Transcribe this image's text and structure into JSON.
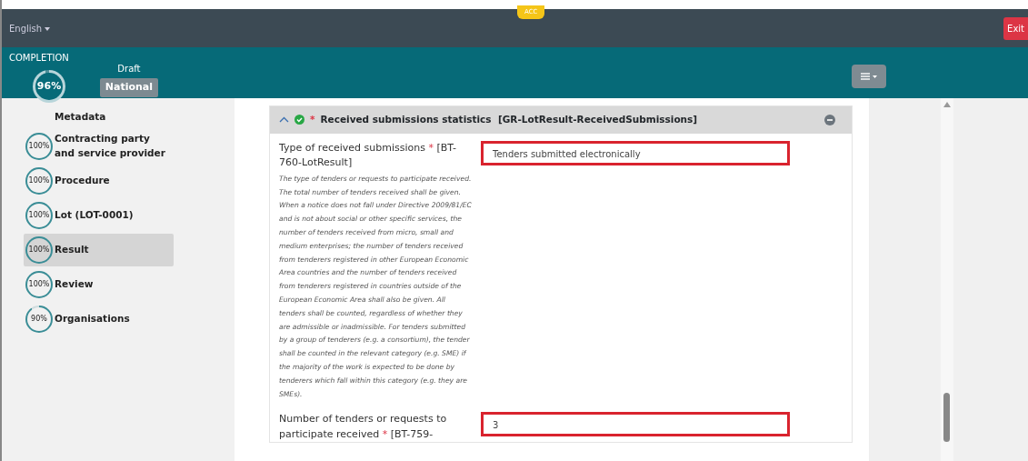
{
  "topbar": {
    "language": "English",
    "env_badge": "ACC",
    "exit_button": "Exit"
  },
  "header": {
    "completion_label": "COMPLETION",
    "completion": {
      "text": "96%",
      "level": 0.96
    },
    "status": "Draft",
    "scope_badge": "National"
  },
  "sidebar": {
    "items": [
      {
        "label": "Metadata",
        "selected": false
      },
      {
        "progress": "100%",
        "level": 1,
        "label": "Contracting party and service provider",
        "selected": false
      },
      {
        "progress": "100%",
        "level": 1,
        "label": "Procedure",
        "selected": false
      },
      {
        "progress": "100%",
        "level": 1,
        "label": "Lot (LOT-0001)",
        "selected": false
      },
      {
        "progress": "100%",
        "level": 1,
        "label": "Result",
        "selected": true
      },
      {
        "progress": "100%",
        "level": 1,
        "label": "Review",
        "selected": false
      },
      {
        "progress": "90%",
        "level": 0.9,
        "label": "Organisations",
        "selected": false
      }
    ]
  },
  "section": {
    "expanded": true,
    "valid": true,
    "required_marker": "*",
    "title": "Received submissions statistics",
    "code": "[GR-LotResult-ReceivedSubmissions]",
    "fields": [
      {
        "label": "Type of received submissions",
        "required_marker": "*",
        "code": "[BT-760-LotResult]",
        "description": "The type of tenders or requests to participate received. The total number of tenders received shall be given. When a notice does not fall under Directive 2009/81/EC and is not about social or other specific services, the number of tenders received from micro, small and medium enterprises; the number of tenders received from tenderers registered in other European Economic Area countries and the number of tenders received from tenderers registered in countries outside of the European Economic Area shall also be given. All tenders shall be counted, regardless of whether they are admissible or inadmissible. For tenders submitted by a group of tenderers (e.g. a consortium), the tender shall be counted in the relevant category (e.g. SME) if the majority of the work is expected to be done by tenderers which fall within this category (e.g. they are SMEs).",
        "value": "Tenders submitted electronically",
        "highlighted": true
      },
      {
        "label": "Number of tenders or requests to participate received",
        "required_marker": "*",
        "code": "[BT-759-",
        "value": "3",
        "highlighted": true
      }
    ]
  }
}
